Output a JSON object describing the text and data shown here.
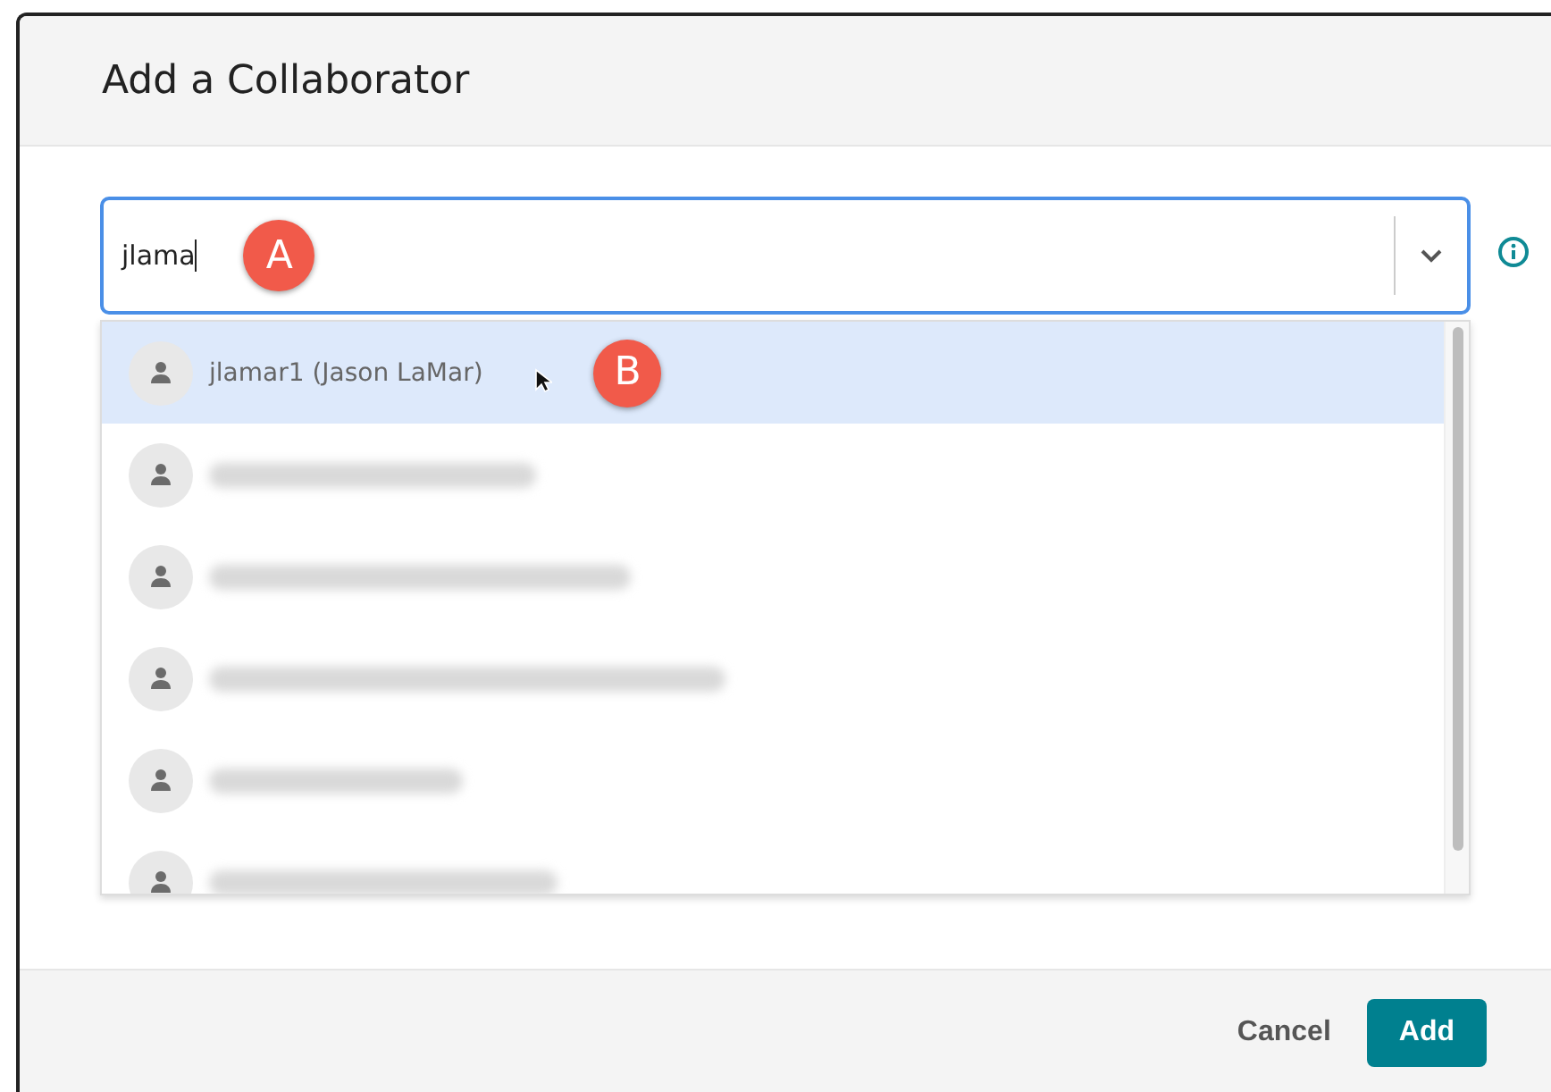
{
  "dialog": {
    "title": "Add a Collaborator"
  },
  "search": {
    "value": "jlama",
    "callout": "A"
  },
  "results": [
    {
      "kind": "user",
      "label": "jlamar1 (Jason LaMar)",
      "selected": true,
      "callout": "B"
    },
    {
      "kind": "redacted",
      "selected": false
    },
    {
      "kind": "redacted",
      "selected": false
    },
    {
      "kind": "redacted",
      "selected": false
    },
    {
      "kind": "redacted",
      "selected": false
    },
    {
      "kind": "redacted",
      "selected": false
    }
  ],
  "buttons": [
    {
      "kind": "secondary",
      "label": "Cancel"
    },
    {
      "kind": "primary",
      "label": "Add"
    }
  ]
}
